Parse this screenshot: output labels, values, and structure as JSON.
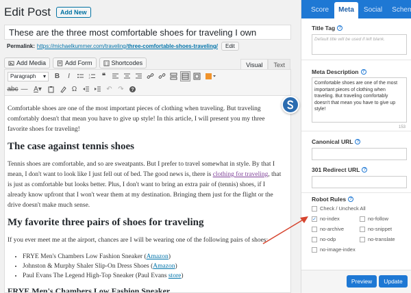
{
  "editor": {
    "page_title": "Edit Post",
    "add_new_label": "Add New",
    "post_title": "These are the three most comfortable shoes for traveling I own",
    "permalink_label": "Permalink:",
    "permalink_base": "https://michaelkummer.com/traveling/",
    "permalink_slug": "three-comfortable-shoes-traveling/",
    "permalink_edit": "Edit",
    "media_buttons": [
      "Add Media",
      "Add Form",
      "Shortcodes"
    ],
    "mode_tabs": [
      "Visual",
      "Text"
    ],
    "format_select": "Paragraph"
  },
  "content": {
    "intro": "Comfortable shoes are one of the most important pieces of clothing when traveling. But traveling comfortably doesn't that mean you have to give up style! In this article, I will present you my three favorite shoes for traveling!",
    "h2_tennis": "The case against tennis shoes",
    "tennis_before": "Tennis shoes are comfortable, and so are sweatpants. But I prefer to travel somewhat in style. By that I mean, I don't want to look like I just fell out of bed. The good news is, there is ",
    "tennis_link": "clothing for traveling",
    "tennis_after": ", that is just as comfortable but looks better. Plus, I don't want to bring an extra pair of (tennis) shoes, if I already know upfront that I won't wear them at my destination. Bringing them just for the flight or the drive doesn't make much sense.",
    "h2_favorites": "My favorite three pairs of shoes for traveling",
    "airport_para": "If you ever meet me at the airport, chances are I will be wearing one of the following pairs of shoes:",
    "list": [
      {
        "text": "FRYE Men's Chambers Low Fashion Sneaker (",
        "link": "Amazon",
        "close": ")"
      },
      {
        "text": "Johnston & Murphy Shaler Slip-On Dress Shoes (",
        "link": "Amazon",
        "close": ")"
      },
      {
        "text": "Paul Evans The Legend High-Top Sneaker (Paul Evans ",
        "link": "store",
        "close": ")"
      }
    ],
    "h3_frye": "FRYE Men's Chambers Low Fashion Sneaker"
  },
  "seo_panel": {
    "tabs": [
      "Score",
      "Meta",
      "Social",
      "Schema"
    ],
    "active_tab": "Meta",
    "title_tag_label": "Title Tag",
    "title_tag_placeholder": "Default title will be used if left blank.",
    "meta_desc_label": "Meta Description",
    "meta_desc_value": "Comfortable shoes are one of the most important pieces of clothing when traveling. But traveling comfortably doesn't that mean you have to give up style!",
    "meta_desc_count": "153",
    "canonical_label": "Canonical URL",
    "redirect_label": "301 Redirect URL",
    "robot_rules_label": "Robot Rules",
    "check_all_label": "Check / Uncheck All",
    "robots": [
      [
        "no-index",
        "no-follow"
      ],
      [
        "no-archive",
        "no-snippet"
      ],
      [
        "no-odp",
        "no-translate"
      ],
      [
        "no-image-index",
        ""
      ]
    ],
    "robots_checked": [
      "no-index"
    ],
    "preview_label": "Preview",
    "update_label": "Update"
  },
  "colors": {
    "accent": "#1e78d4",
    "arrow": "#d6452f",
    "link": "#0073aa",
    "visited_link": "#7e3f98"
  }
}
